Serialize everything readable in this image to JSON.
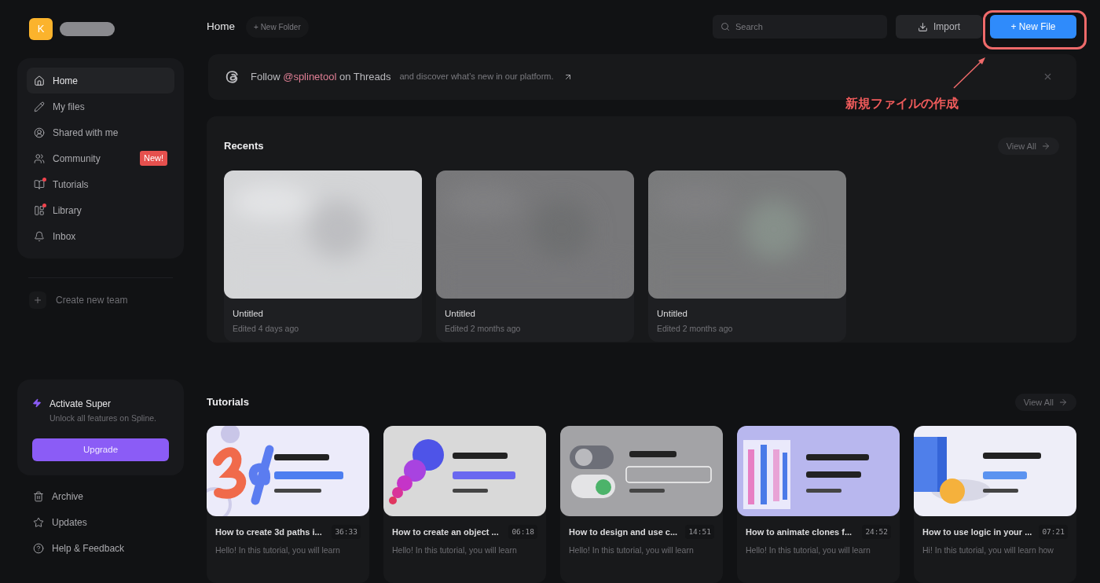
{
  "account": {
    "initial": "K"
  },
  "sidebar": {
    "items": [
      {
        "label": "Home",
        "kind": "home",
        "selected": true,
        "dot": false
      },
      {
        "label": "My files",
        "kind": "files",
        "selected": false,
        "dot": false
      },
      {
        "label": "Shared with me",
        "kind": "shared",
        "selected": false,
        "dot": false
      },
      {
        "label": "Community",
        "kind": "community",
        "selected": false,
        "dot": false,
        "badge": "New!"
      },
      {
        "label": "Tutorials",
        "kind": "tutorials",
        "selected": false,
        "dot": true
      },
      {
        "label": "Library",
        "kind": "library",
        "selected": false,
        "dot": true
      },
      {
        "label": "Inbox",
        "kind": "inbox",
        "selected": false,
        "dot": false
      }
    ],
    "create_team": "Create new team",
    "promo": {
      "title": "Activate Super",
      "subtitle": "Unlock all features on Spline.",
      "button": "Upgrade"
    },
    "bottom_items": [
      {
        "label": "Archive",
        "kind": "archive"
      },
      {
        "label": "Updates",
        "kind": "updates"
      },
      {
        "label": "Help & Feedback",
        "kind": "help"
      }
    ]
  },
  "header": {
    "title": "Home",
    "new_folder": "+ New Folder",
    "search": {
      "placeholder": "Search"
    },
    "import": "Import",
    "new_file": "+ New File"
  },
  "banner": {
    "text": "Follow **@splinetool** on Threads",
    "subtext": "and discover what’s new in our platform."
  },
  "recents": {
    "title": "Recents",
    "view_all": "View All",
    "files": [
      {
        "name": "Untitled",
        "edited": "Edited 4 days ago",
        "kind": "picture"
      },
      {
        "name": "Untitled",
        "edited": "Edited 2 months ago",
        "kind": "picture"
      },
      {
        "name": "Untitled",
        "edited": "Edited 2 months ago",
        "kind": "picture"
      }
    ]
  },
  "tutorials": {
    "title": "Tutorials",
    "view_all": "View All",
    "items": [
      {
        "title": "How to create 3d paths i...",
        "duration": "36:33",
        "description": "Hello! In this tutorial, you will learn",
        "kind": "picture"
      },
      {
        "title": "How to create an object ...",
        "duration": "06:18",
        "description": "Hello! In this tutorial, you will learn",
        "kind": "picture"
      },
      {
        "title": "How to design and use c...",
        "duration": "14:51",
        "description": "Hello! In this tutorial, you will learn",
        "kind": "picture"
      },
      {
        "title": "How to animate clones f...",
        "duration": "24:52",
        "description": "Hello! In this tutorial, you will learn",
        "kind": "picture"
      },
      {
        "title": "How to use logic in your ...",
        "duration": "07:21",
        "description": "Hi! In this tutorial, you will learn how",
        "kind": "picture"
      }
    ]
  },
  "annotation": {
    "text": "新規ファイルの作成"
  }
}
